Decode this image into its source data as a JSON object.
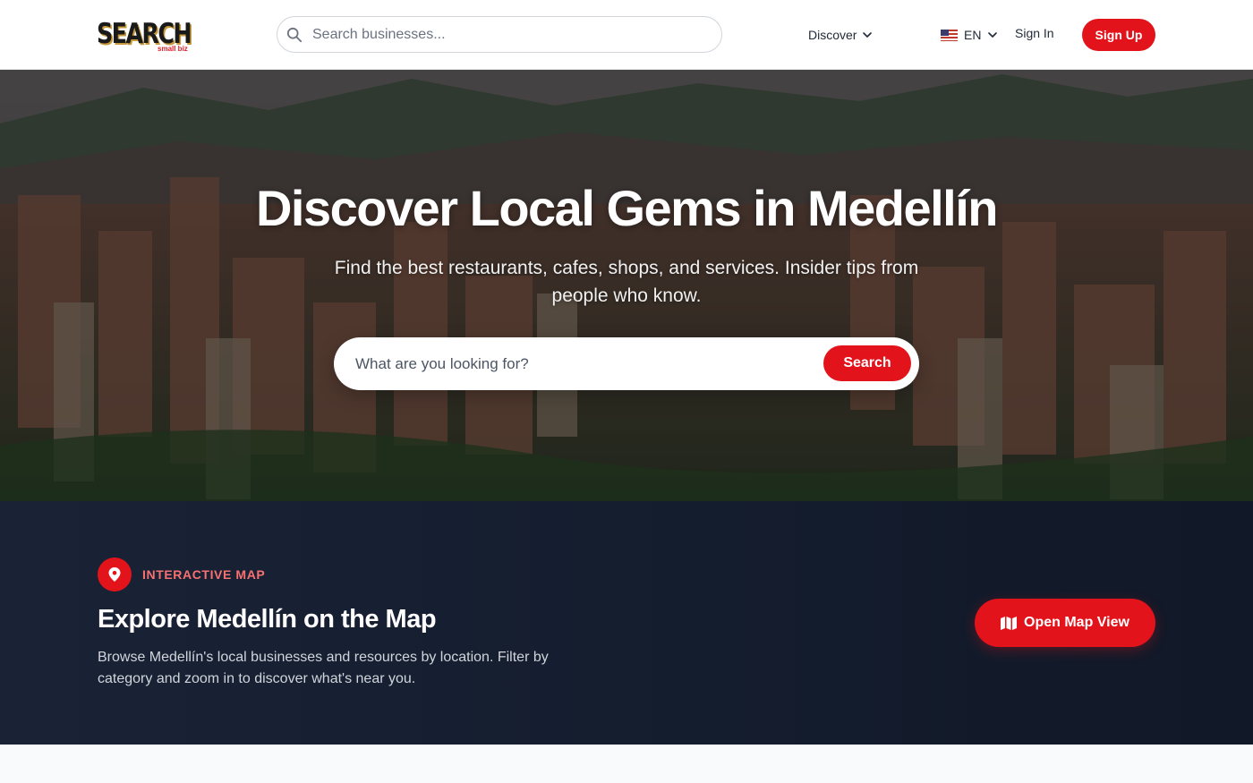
{
  "header": {
    "logo_text": "SEARCH",
    "logo_subtext": "small biz",
    "search_placeholder": "Search businesses...",
    "discover_label": "Discover",
    "language_label": "EN",
    "signin_label": "Sign In",
    "signup_label": "Sign Up"
  },
  "hero": {
    "title": "Discover Local Gems in Medellín",
    "subtitle": "Find the best restaurants, cafes, shops, and services. Insider tips from people who know.",
    "search_placeholder": "What are you looking for?",
    "search_button": "Search"
  },
  "map_section": {
    "eyebrow": "INTERACTIVE MAP",
    "title": "Explore Medellín on the Map",
    "description": "Browse Medellín's local businesses and resources by location. Filter by category and zoom in to discover what's near you.",
    "button_label": "Open Map View"
  },
  "icons": {
    "search": "search-icon",
    "chevron": "chevron-down-icon",
    "flag": "us-flag-icon",
    "pin": "map-pin-icon",
    "map": "map-icon"
  },
  "colors": {
    "accent": "#e3131c",
    "eyebrow": "#f87171",
    "dark_section": "#141d2e"
  }
}
